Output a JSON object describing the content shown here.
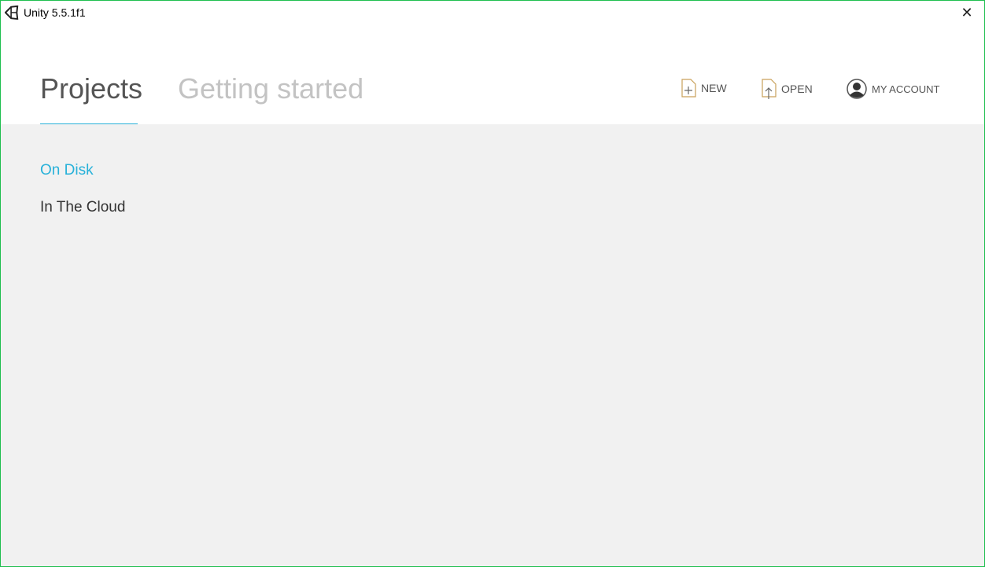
{
  "window": {
    "title": "Unity 5.5.1f1"
  },
  "tabs": [
    {
      "label": "Projects",
      "active": true
    },
    {
      "label": "Getting started",
      "active": false
    }
  ],
  "actions": {
    "new": "NEW",
    "open": "OPEN",
    "account": "MY ACCOUNT"
  },
  "sidebar": {
    "items": [
      {
        "label": "On Disk",
        "active": true
      },
      {
        "label": "In The Cloud",
        "active": false
      }
    ]
  },
  "colors": {
    "accent": "#27b1d9",
    "background": "#f1f1f1"
  }
}
